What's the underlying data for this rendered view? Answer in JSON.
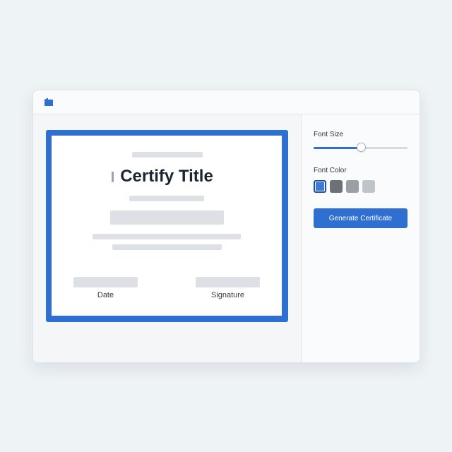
{
  "app": {
    "logo_icon": "folder-tab-icon",
    "accent_color": "#2f6fd1"
  },
  "certificate": {
    "title": "Certify Title",
    "footer": {
      "date_label": "Date",
      "signature_label": "Signature"
    },
    "border_color": "#2f6fd1"
  },
  "panel": {
    "font_size": {
      "label": "Font Size",
      "value_fraction": 0.51
    },
    "font_color": {
      "label": "Font Color",
      "swatches": [
        {
          "color": "#3b7ad9",
          "selected": true
        },
        {
          "color": "#6b7177",
          "selected": false
        },
        {
          "color": "#9aa0a6",
          "selected": false
        },
        {
          "color": "#bfc4c9",
          "selected": false
        }
      ]
    },
    "generate_button_label": "Generate Certificate"
  }
}
